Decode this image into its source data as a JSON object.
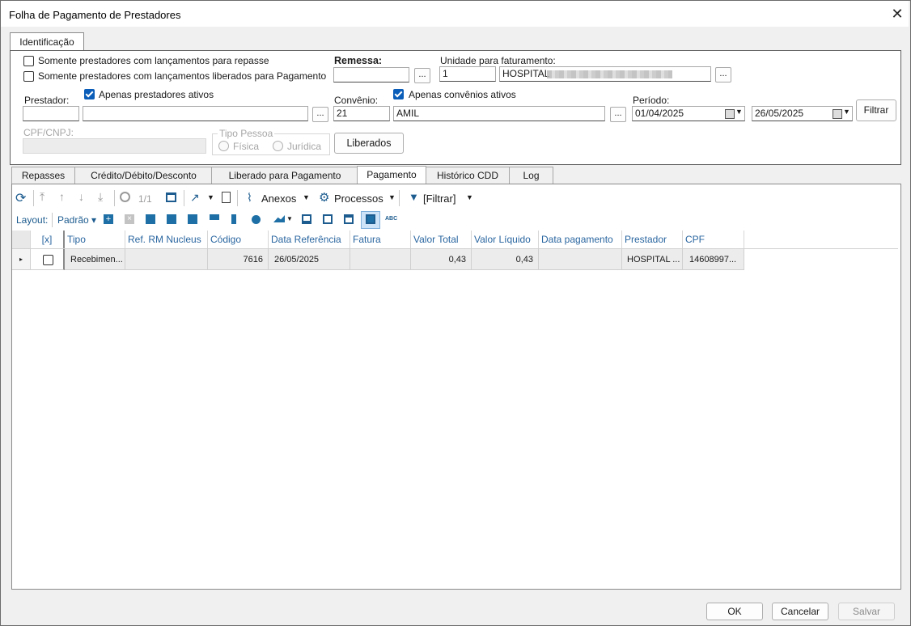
{
  "window": {
    "title": "Folha de Pagamento de Prestadores",
    "close": "✕"
  },
  "top_tab": {
    "label": "Identificação"
  },
  "filters": {
    "chk_repasse": {
      "label": "Somente prestadores com lançamentos para repasse",
      "checked": false
    },
    "chk_liberados": {
      "label": "Somente prestadores com lançamentos liberados para Pagamento",
      "checked": false
    },
    "remessa": {
      "label": "Remessa:",
      "value": ""
    },
    "unidade": {
      "label": "Unidade para faturamento:",
      "code": "1",
      "name": "HOSPITAL"
    },
    "prestador": {
      "label": "Prestador:",
      "code": "",
      "name": ""
    },
    "chk_prest_ativos": {
      "label": "Apenas prestadores ativos",
      "checked": true
    },
    "convenio": {
      "label": "Convênio:",
      "code": "21",
      "name": "AMIL"
    },
    "chk_conv_ativos": {
      "label": "Apenas convênios ativos",
      "checked": true
    },
    "periodo": {
      "label": "Período:",
      "start": "01/04/2025",
      "end": "26/05/2025"
    },
    "filtrar_btn": "Filtrar",
    "cpf": {
      "label": "CPF/CNPJ:",
      "value": ""
    },
    "tipo_pessoa": {
      "label": "Tipo Pessoa",
      "fisica": "Física",
      "juridica": "Jurídica"
    },
    "liberados_btn": "Liberados",
    "dots": "..."
  },
  "tabs": [
    "Repasses",
    "Crédito/Débito/Desconto",
    "Liberado para Pagamento",
    "Pagamento",
    "Histórico CDD",
    "Log"
  ],
  "active_tab": "Pagamento",
  "toolbar": {
    "page": "1/1",
    "anexos": "Anexos",
    "processos": "Processos",
    "filtrar": "[Filtrar]"
  },
  "layout_bar": {
    "layout": "Layout:",
    "padrao": "Padrão ▾",
    "abc": "ABC"
  },
  "grid": {
    "columns": [
      "[x]",
      "Tipo",
      "Ref. RM Nucleus",
      "Código",
      "Data Referência",
      "Fatura",
      "Valor Total",
      "Valor Líquido",
      "Data pagamento",
      "Prestador",
      "CPF"
    ],
    "rows": [
      {
        "tipo": "Recebimen...",
        "ref": "",
        "codigo": "7616",
        "data_ref": "26/05/2025",
        "fatura": "",
        "valor_total": "0,43",
        "valor_liquido": "0,43",
        "data_pag": "",
        "prestador": "HOSPITAL ...",
        "cpf": "14608997..."
      }
    ]
  },
  "footer": {
    "ok": "OK",
    "cancelar": "Cancelar",
    "salvar": "Salvar"
  },
  "colors": {
    "accent": "#0a5db8",
    "toolbar_icon": "#1d6fa5",
    "header_text": "#2a66a0"
  }
}
